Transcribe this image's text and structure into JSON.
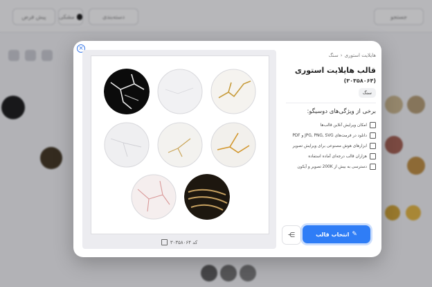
{
  "background": {
    "chips": [
      "پیش فرض",
      "جستجو",
      "دسته‌بندی"
    ],
    "color_chip_label": "مشکی"
  },
  "modal": {
    "close_glyph": "×",
    "breadcrumb": [
      "هایلایت استوری",
      "سنگ"
    ],
    "breadcrumb_sep": "‹",
    "title": "قالب هایلایت استوری",
    "code_label": "(۳۰۳۵۸۰۶۴)",
    "tag": "سنگ",
    "features_title": "برخی از ویژگی‌های دوسیگو:",
    "features": [
      "امکان ویرایش آنلاین قالب‌ها",
      "دانلود در فرمت‌های JPG, PNG, SVG و PDF",
      "ابزارهای هوش مصنوعی برای ویرایش تصویر",
      "هزاران قالب درجه‌ای آماده استفاده",
      "دسترسی به بیش از 200K تصویر و آیکون"
    ],
    "feature_icons": [
      "edit-icon",
      "download-icon",
      "ai-image-icon",
      "template-icon",
      "image-library-icon"
    ],
    "select_button": "انتخاب قالب",
    "share_glyph": "⋲",
    "preview_code": "کد ۳۰۳۵۸۰۶۴"
  },
  "colors": {
    "accent": "#2f7df6",
    "overlay": "#282830"
  }
}
